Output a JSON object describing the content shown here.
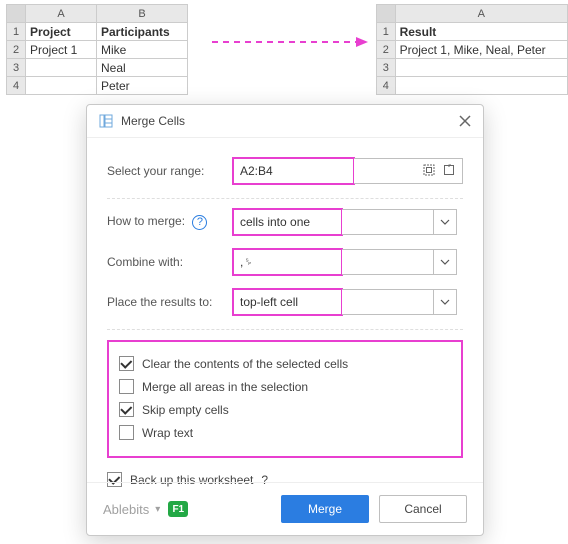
{
  "sheet_left": {
    "col_headers": [
      "A",
      "B"
    ],
    "row_headers": [
      "1",
      "2",
      "3",
      "4"
    ],
    "rows": [
      {
        "a": "Project",
        "b": "Participants",
        "bold": true
      },
      {
        "a": "Project 1",
        "b": "Mike",
        "bold": false
      },
      {
        "a": "",
        "b": "Neal",
        "bold": false
      },
      {
        "a": "",
        "b": "Peter",
        "bold": false
      }
    ]
  },
  "sheet_right": {
    "col_headers": [
      "A"
    ],
    "row_headers": [
      "1",
      "2",
      "3",
      "4"
    ],
    "rows": [
      {
        "a": "Result",
        "bold": true
      },
      {
        "a": "Project 1, Mike, Neal, Peter",
        "bold": false
      },
      {
        "a": "",
        "bold": false
      },
      {
        "a": "",
        "bold": false
      }
    ]
  },
  "dialog": {
    "title": "Merge Cells",
    "labels": {
      "range": "Select your range:",
      "how": "How to merge:",
      "combine": "Combine with:",
      "place": "Place the results to:"
    },
    "values": {
      "range": "A2:B4",
      "how": "cells into one",
      "combine": ",␠",
      "place": "top-left cell"
    },
    "checks": {
      "clear": "Clear the contents of the selected cells",
      "merge_areas": "Merge all areas in the selection",
      "skip_empty": "Skip empty cells",
      "wrap": "Wrap text",
      "backup": "Back up this worksheet"
    },
    "checked": {
      "clear": true,
      "merge_areas": false,
      "skip_empty": true,
      "wrap": false,
      "backup": true
    },
    "buttons": {
      "merge": "Merge",
      "cancel": "Cancel"
    },
    "brand": "Ablebits",
    "f1": "F1"
  }
}
